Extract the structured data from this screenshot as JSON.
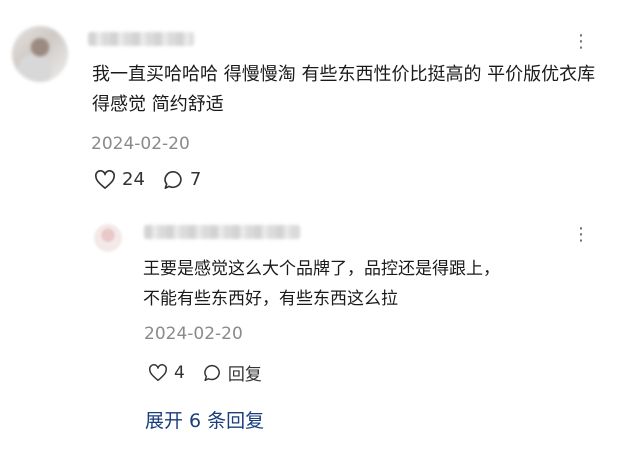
{
  "comment": {
    "text": "我一直买哈哈哈 得慢慢淘 有些东西性价比挺高的 平价版优衣库得感觉 简约舒适",
    "date": "2024-02-20",
    "likes": "24",
    "replies": "7",
    "more_glyph": "⋮"
  },
  "reply": {
    "text_line1": "王要是感觉这么大个品牌了，品控还是得跟上，",
    "text_line2": "不能有些东西好，有些东西这么拉",
    "date": "2024-02-20",
    "likes": "4",
    "reply_label": "回复",
    "more_glyph": "⋮"
  },
  "expand_label": "展开 6 条回复",
  "icons": {
    "like": "heart-icon",
    "comment": "chat-bubble-icon",
    "more": "more-dots-icon"
  }
}
